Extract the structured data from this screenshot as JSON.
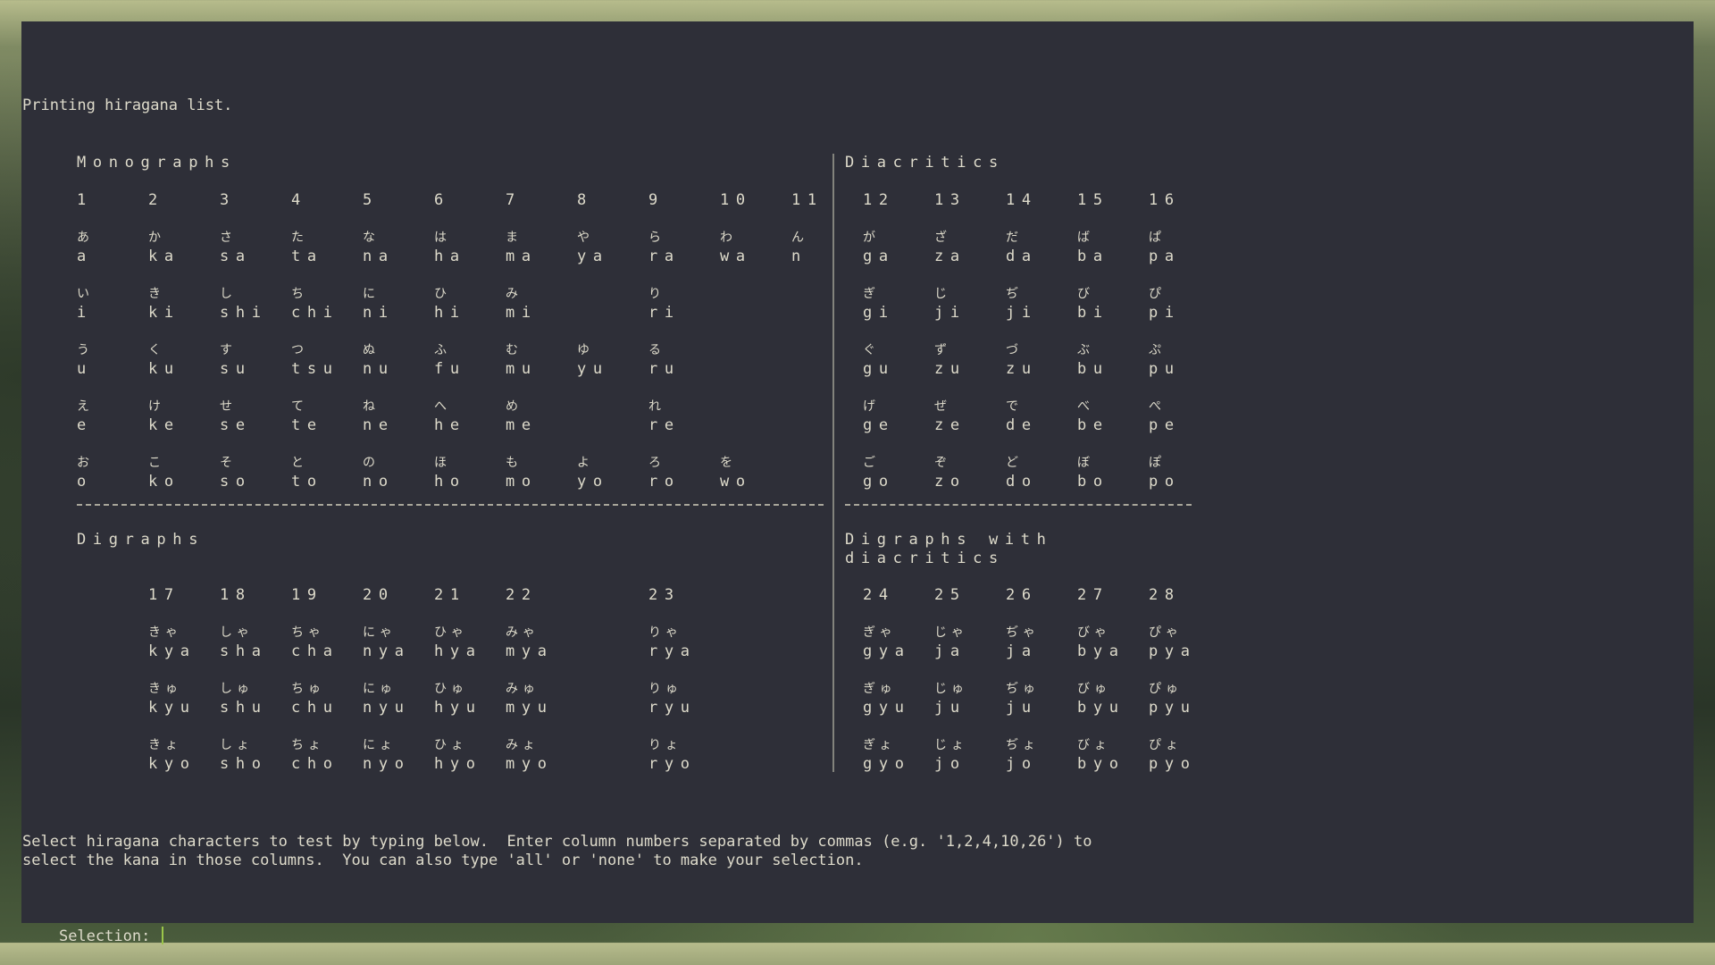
{
  "intro": "Printing hiragana list.",
  "sections": {
    "monographs": "Monographs",
    "diacritics": "Diacritics",
    "digraphs": "Digraphs",
    "digraphs_with_diacritics_line1": "Digraphs with",
    "digraphs_with_diacritics_line2": "diacritics"
  },
  "monograph_columns": [
    "1",
    "2",
    "3",
    "4",
    "5",
    "6",
    "7",
    "8",
    "9",
    "10",
    "11"
  ],
  "monograph_rows": [
    {
      "kana": [
        "あ",
        "か",
        "さ",
        "た",
        "な",
        "は",
        "ま",
        "や",
        "ら",
        "わ",
        "ん"
      ],
      "romaji": [
        "a",
        "ka",
        "sa",
        "ta",
        "na",
        "ha",
        "ma",
        "ya",
        "ra",
        "wa",
        "n"
      ]
    },
    {
      "kana": [
        "い",
        "き",
        "し",
        "ち",
        "に",
        "ひ",
        "み",
        "",
        "り",
        "",
        ""
      ],
      "romaji": [
        "i",
        "ki",
        "shi",
        "chi",
        "ni",
        "hi",
        "mi",
        "",
        "ri",
        "",
        ""
      ]
    },
    {
      "kana": [
        "う",
        "く",
        "す",
        "つ",
        "ぬ",
        "ふ",
        "む",
        "ゆ",
        "る",
        "",
        ""
      ],
      "romaji": [
        "u",
        "ku",
        "su",
        "tsu",
        "nu",
        "fu",
        "mu",
        "yu",
        "ru",
        "",
        ""
      ]
    },
    {
      "kana": [
        "え",
        "け",
        "せ",
        "て",
        "ね",
        "へ",
        "め",
        "",
        "れ",
        "",
        ""
      ],
      "romaji": [
        "e",
        "ke",
        "se",
        "te",
        "ne",
        "he",
        "me",
        "",
        "re",
        "",
        ""
      ]
    },
    {
      "kana": [
        "お",
        "こ",
        "そ",
        "と",
        "の",
        "ほ",
        "も",
        "よ",
        "ろ",
        "を",
        ""
      ],
      "romaji": [
        "o",
        "ko",
        "so",
        "to",
        "no",
        "ho",
        "mo",
        "yo",
        "ro",
        "wo",
        ""
      ]
    }
  ],
  "diacritic_columns": [
    "12",
    "13",
    "14",
    "15",
    "16"
  ],
  "diacritic_rows": [
    {
      "kana": [
        "が",
        "ざ",
        "だ",
        "ば",
        "ぱ"
      ],
      "romaji": [
        "ga",
        "za",
        "da",
        "ba",
        "pa"
      ]
    },
    {
      "kana": [
        "ぎ",
        "じ",
        "ぢ",
        "び",
        "ぴ"
      ],
      "romaji": [
        "gi",
        "ji",
        "ji",
        "bi",
        "pi"
      ]
    },
    {
      "kana": [
        "ぐ",
        "ず",
        "づ",
        "ぶ",
        "ぷ"
      ],
      "romaji": [
        "gu",
        "zu",
        "zu",
        "bu",
        "pu"
      ]
    },
    {
      "kana": [
        "げ",
        "ぜ",
        "で",
        "べ",
        "ぺ"
      ],
      "romaji": [
        "ge",
        "ze",
        "de",
        "be",
        "pe"
      ]
    },
    {
      "kana": [
        "ご",
        "ぞ",
        "ど",
        "ぼ",
        "ぽ"
      ],
      "romaji": [
        "go",
        "zo",
        "do",
        "bo",
        "po"
      ]
    }
  ],
  "digraph_columns": [
    "",
    "17",
    "18",
    "19",
    "20",
    "21",
    "22",
    "",
    "23"
  ],
  "digraph_rows": [
    {
      "kana": [
        "",
        "きゃ",
        "しゃ",
        "ちゃ",
        "にゃ",
        "ひゃ",
        "みゃ",
        "",
        "りゃ"
      ],
      "romaji": [
        "",
        "kya",
        "sha",
        "cha",
        "nya",
        "hya",
        "mya",
        "",
        "rya"
      ]
    },
    {
      "kana": [
        "",
        "きゅ",
        "しゅ",
        "ちゅ",
        "にゅ",
        "ひゅ",
        "みゅ",
        "",
        "りゅ"
      ],
      "romaji": [
        "",
        "kyu",
        "shu",
        "chu",
        "nyu",
        "hyu",
        "myu",
        "",
        "ryu"
      ]
    },
    {
      "kana": [
        "",
        "きょ",
        "しょ",
        "ちょ",
        "にょ",
        "ひょ",
        "みょ",
        "",
        "りょ"
      ],
      "romaji": [
        "",
        "kyo",
        "sho",
        "cho",
        "nyo",
        "hyo",
        "myo",
        "",
        "ryo"
      ]
    }
  ],
  "digraph_dia_columns": [
    "24",
    "25",
    "26",
    "27",
    "28"
  ],
  "digraph_dia_rows": [
    {
      "kana": [
        "ぎゃ",
        "じゃ",
        "ぢゃ",
        "びゃ",
        "ぴゃ"
      ],
      "romaji": [
        "gya",
        "ja",
        "ja",
        "bya",
        "pya"
      ]
    },
    {
      "kana": [
        "ぎゅ",
        "じゅ",
        "ぢゅ",
        "びゅ",
        "ぴゅ"
      ],
      "romaji": [
        "gyu",
        "ju",
        "ju",
        "byu",
        "pyu"
      ]
    },
    {
      "kana": [
        "ぎょ",
        "じょ",
        "ぢょ",
        "びょ",
        "ぴょ"
      ],
      "romaji": [
        "gyo",
        "jo",
        "jo",
        "byo",
        "pyo"
      ]
    }
  ],
  "instructions_line1": "Select hiragana characters to test by typing below.  Enter column numbers separated by commas (e.g. '1,2,4,10,26') to",
  "instructions_line2": "select the kana in those columns.  You can also type 'all' or 'none' to make your selection.",
  "prompt_label": "Selection:",
  "input_value": ""
}
